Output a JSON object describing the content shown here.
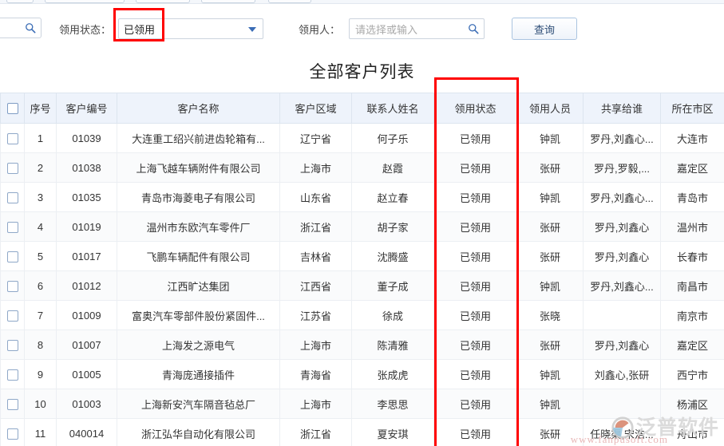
{
  "toolbar": {
    "status_label": "领用状态：",
    "status_value": "已领用",
    "owner_label": "领用人：",
    "owner_placeholder": "请选择或输入",
    "query_button": "查询",
    "search_icon": "search-icon",
    "caret_icon": "chevron-down-icon"
  },
  "title": "全部客户列表",
  "table": {
    "columns": [
      {
        "key": "chk",
        "label": ""
      },
      {
        "key": "idx",
        "label": "序号"
      },
      {
        "key": "code",
        "label": "客户编号"
      },
      {
        "key": "name",
        "label": "客户名称"
      },
      {
        "key": "area",
        "label": "客户区域"
      },
      {
        "key": "ct",
        "label": "联系人姓名"
      },
      {
        "key": "st",
        "label": "领用状态"
      },
      {
        "key": "who",
        "label": "领用人员"
      },
      {
        "key": "share",
        "label": "共享给谁"
      },
      {
        "key": "city",
        "label": "所在市区"
      }
    ],
    "rows": [
      {
        "idx": "1",
        "code": "01039",
        "name": "大连重工绍兴前进齿轮箱有...",
        "area": "辽宁省",
        "ct": "何子乐",
        "st": "已领用",
        "who": "钟凯",
        "share": "罗丹,刘鑫心...",
        "city": "大连市"
      },
      {
        "idx": "2",
        "code": "01038",
        "name": "上海飞越车辆附件有限公司",
        "area": "上海市",
        "ct": "赵霞",
        "st": "已领用",
        "who": "张研",
        "share": "罗丹,罗毅,...",
        "city": "嘉定区"
      },
      {
        "idx": "3",
        "code": "01035",
        "name": "青岛市海菱电子有限公司",
        "area": "山东省",
        "ct": "赵立春",
        "st": "已领用",
        "who": "钟凯",
        "share": "罗丹,刘鑫心...",
        "city": "青岛市"
      },
      {
        "idx": "4",
        "code": "01019",
        "name": "温州市东欧汽车零件厂",
        "area": "浙江省",
        "ct": "胡子家",
        "st": "已领用",
        "who": "张研",
        "share": "罗丹,刘鑫心",
        "city": "温州市"
      },
      {
        "idx": "5",
        "code": "01017",
        "name": "飞鹏车辆配件有限公司",
        "area": "吉林省",
        "ct": "沈腾盛",
        "st": "已领用",
        "who": "张研",
        "share": "罗丹,刘鑫心",
        "city": "长春市"
      },
      {
        "idx": "6",
        "code": "01012",
        "name": "江西旷达集团",
        "area": "江西省",
        "ct": "董子成",
        "st": "已领用",
        "who": "钟凯",
        "share": "罗丹,刘鑫心...",
        "city": "南昌市"
      },
      {
        "idx": "7",
        "code": "01009",
        "name": "富奥汽车零部件股份紧固件...",
        "area": "江苏省",
        "ct": "徐成",
        "st": "已领用",
        "who": "张晓",
        "share": "",
        "city": "南京市"
      },
      {
        "idx": "8",
        "code": "01007",
        "name": "上海发之源电气",
        "area": "上海市",
        "ct": "陈清雅",
        "st": "已领用",
        "who": "张研",
        "share": "罗丹,刘鑫心",
        "city": "嘉定区"
      },
      {
        "idx": "9",
        "code": "01005",
        "name": "青海庞通接插件",
        "area": "青海省",
        "ct": "张成虎",
        "st": "已领用",
        "who": "钟凯",
        "share": "刘鑫心,张研",
        "city": "西宁市"
      },
      {
        "idx": "10",
        "code": "01003",
        "name": "上海新安汽车隔音毡总厂",
        "area": "上海市",
        "ct": "李思思",
        "st": "已领用",
        "who": "钟凯",
        "share": "",
        "city": "杨浦区"
      },
      {
        "idx": "11",
        "code": "040014",
        "name": "浙江弘华自动化有限公司",
        "area": "浙江省",
        "ct": "夏安琪",
        "st": "已领用",
        "who": "张研",
        "share": "任晓渠,宋浩...",
        "city": "舟山市"
      }
    ]
  },
  "watermark": {
    "brand": "泛普软件",
    "domain": "www.fanpusoft.com"
  },
  "colors": {
    "accent": "#5b6fd6",
    "status_ok": "#1aa81a",
    "annotation": "#ff0000",
    "header_bg": "#eef3fb"
  }
}
